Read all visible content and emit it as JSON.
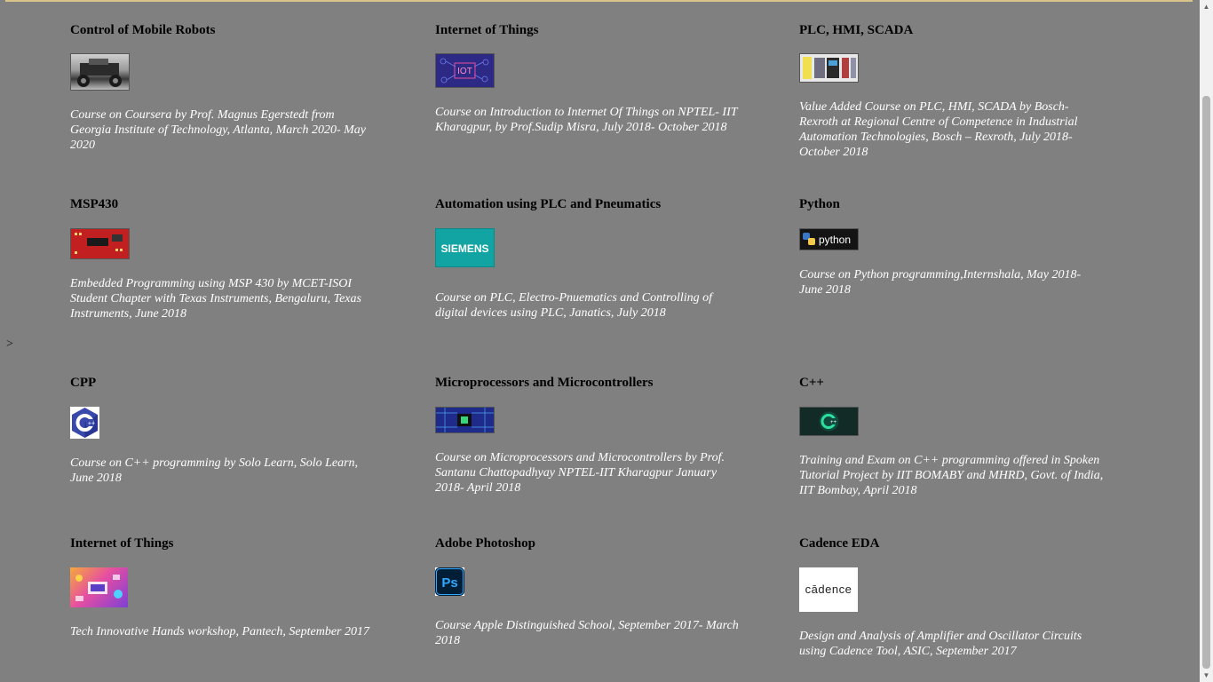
{
  "stray_text": ">",
  "courses": [
    {
      "title": "Control of Mobile Robots",
      "image": "mobile-robot-photo",
      "desc": "Course on Coursera by Prof. Magnus Egerstedt from Georgia Institute of Technology, Atlanta, March 2020- May 2020"
    },
    {
      "title": "Internet of Things",
      "image": "iot-banner",
      "image_text": "IOT",
      "desc": "Course on Introduction to Internet Of Things on NPTEL- IIT Kharagpur, by Prof.Sudip Misra, July 2018- October 2018"
    },
    {
      "title": "PLC, HMI, SCADA",
      "image": "plc-hardware-photo",
      "desc": "Value Added Course on PLC, HMI, SCADA by Bosch- Rexroth at Regional Centre of Competence in Industrial Automation Technologies, Bosch – Rexroth, July 2018- October 2018"
    },
    {
      "title": "MSP430",
      "image": "msp430-board-photo",
      "desc": "Embedded Programming using MSP 430 by MCET-ISOI Student Chapter with Texas Instruments, Bengaluru, Texas Instruments, June 2018"
    },
    {
      "title": "Automation using PLC and Pneumatics",
      "image": "siemens-logo",
      "image_text": "SIEMENS",
      "desc": "Course on PLC, Electro-Pnuematics and Controlling of digital devices using PLC, Janatics, July 2018"
    },
    {
      "title": "Python",
      "image": "python-logo",
      "image_text": "python",
      "desc": "Course on Python programming,Internshala, May 2018- June 2018"
    },
    {
      "title": "CPP",
      "image": "cpp-logo",
      "image_text": "C++",
      "desc": "Course on C++ programming by Solo Learn, Solo Learn, June 2018"
    },
    {
      "title": "Microprocessors and Microcontrollers",
      "image": "microchip-photo",
      "desc": "Course on Microprocessors and Microcontrollers by Prof. Santanu Chattopadhyay NPTEL-IIT Kharagpur January 2018- April 2018"
    },
    {
      "title": "C++",
      "image": "cpp-green-logo",
      "image_text": "C++",
      "desc": "Training and Exam on C++ programming offered in Spoken Tutorial Project by IIT BOMABY and MHRD, Govt. of India, IIT Bombay, April 2018"
    },
    {
      "title": "Internet of Things",
      "image": "iot-illustration",
      "desc": "Tech Innovative Hands workshop, Pantech, September 2017"
    },
    {
      "title": "Adobe Photoshop",
      "image": "photoshop-logo",
      "image_text": "Ps",
      "desc": "Course Apple Distinguished School, September 2017- March 2018"
    },
    {
      "title": "Cadence EDA",
      "image": "cadence-logo",
      "image_text": "cādence",
      "desc": "Design and Analysis of Amplifier and Oscillator Circuits using Cadence Tool, ASIC, September 2017"
    }
  ],
  "colors": {
    "background": "#808080",
    "accent_rule": "#d9c48a",
    "description_text": "#ffffff"
  }
}
